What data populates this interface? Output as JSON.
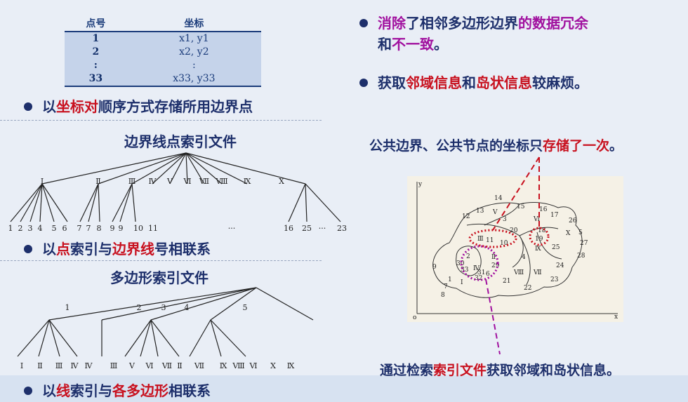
{
  "table": {
    "headers": [
      "点号",
      "坐标"
    ],
    "rows": [
      {
        "id": "1",
        "coord": "x1, y1"
      },
      {
        "id": "2",
        "coord": "x2, y2"
      },
      {
        "id": ":",
        "coord": ":"
      },
      {
        "id": "33",
        "coord": "x33, y33"
      }
    ]
  },
  "left": {
    "bullet1": {
      "a": "以",
      "b": "坐标对",
      "c": "顺序方式存储所用边界点"
    },
    "heading1": "边界线点索引文件",
    "tree1_top_labels": [
      "I",
      "Ⅱ",
      "Ⅲ",
      "Ⅳ",
      "Ⅴ",
      "Ⅵ",
      "Ⅶ",
      "Ⅷ",
      "Ⅸ",
      "X"
    ],
    "tree1_bottom_labels": [
      "1",
      "2",
      "3",
      "4",
      "5",
      "6",
      "7",
      "7",
      "8",
      "9",
      "9",
      "10",
      "11",
      "···",
      "16",
      "25",
      "···",
      "23"
    ],
    "bullet2": {
      "a": "以",
      "b": "点",
      "c": "索引与",
      "d": "边界线",
      "e": "号相联系"
    },
    "heading2": "多边形索引文件",
    "tree2_top_labels": [
      "1",
      "2",
      "3",
      "4",
      "5"
    ],
    "tree2_bottom_labels": [
      "I",
      "Ⅱ",
      "Ⅲ",
      "Ⅳ",
      "Ⅳ",
      "Ⅲ",
      "Ⅴ",
      "Ⅵ",
      "Ⅶ",
      "Ⅱ",
      "Ⅶ",
      "Ⅸ",
      "Ⅷ",
      "Ⅵ",
      "X",
      "Ⅸ"
    ],
    "bullet3": {
      "a": "以",
      "b": "线",
      "c": "索引与",
      "d": "各多边形",
      "e": "相联系"
    }
  },
  "right": {
    "bullet1": {
      "a": "消除",
      "b": "了相邻多边形边界",
      "c": "的数据冗余",
      "d": "和",
      "e": "不一致",
      "f": "。"
    },
    "bullet2": {
      "a": "获取",
      "b": "邻域信息",
      "c": "和",
      "d": "岛状信息",
      "e": "较麻烦。"
    },
    "note1": {
      "a": "公共边界、公共节点的坐标只",
      "b": "存储了一次",
      "c": "。"
    },
    "note2": {
      "a": "通过检索",
      "b": "索引文件",
      "c": "获取邻域和岛状信息。"
    },
    "map_labels": [
      "y",
      "x",
      "o",
      "1",
      "2",
      "3",
      "4",
      "5",
      "6",
      "7",
      "8",
      "9",
      "10",
      "11",
      "12",
      "13",
      "14",
      "15",
      "16",
      "17",
      "18",
      "19",
      "20",
      "21",
      "22",
      "23",
      "24",
      "25",
      "26",
      "27",
      "28",
      "29",
      "30",
      "31",
      "32",
      "33",
      "Ⅰ",
      "Ⅱ",
      "Ⅲ",
      "Ⅳ",
      "Ⅴ",
      "Ⅵ",
      "Ⅶ",
      "Ⅷ",
      "Ⅸ",
      "X"
    ]
  },
  "colors": {
    "navy": "#1d2f6b",
    "red": "#c8101e",
    "purple": "#a1119f",
    "table_fill": "#c5d3ea"
  }
}
